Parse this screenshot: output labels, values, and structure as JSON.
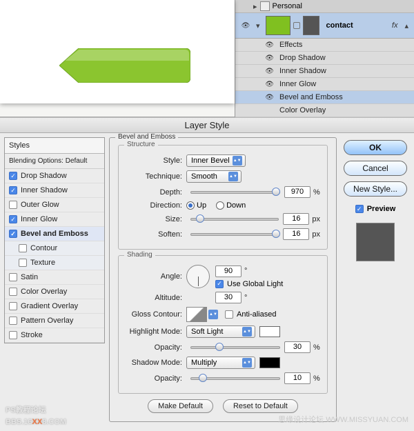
{
  "layers": {
    "personal_label": "Personal",
    "current_layer": "contact",
    "fx_badge": "fx",
    "effects_label": "Effects",
    "effects": [
      "Drop Shadow",
      "Inner Shadow",
      "Inner Glow",
      "Bevel and Emboss",
      "Color Overlay"
    ]
  },
  "dialog": {
    "title": "Layer Style",
    "styles_header": "Styles",
    "blending_label": "Blending Options: Default",
    "style_list": [
      {
        "label": "Drop Shadow",
        "checked": true
      },
      {
        "label": "Inner Shadow",
        "checked": true
      },
      {
        "label": "Outer Glow",
        "checked": false
      },
      {
        "label": "Inner Glow",
        "checked": true
      },
      {
        "label": "Bevel and Emboss",
        "checked": true,
        "selected": true
      },
      {
        "label": "Contour",
        "checked": false,
        "sub": true
      },
      {
        "label": "Texture",
        "checked": false,
        "sub": true
      },
      {
        "label": "Satin",
        "checked": false
      },
      {
        "label": "Color Overlay",
        "checked": false
      },
      {
        "label": "Gradient Overlay",
        "checked": false
      },
      {
        "label": "Pattern Overlay",
        "checked": false
      },
      {
        "label": "Stroke",
        "checked": false
      }
    ],
    "panel_title": "Bevel and Emboss",
    "structure": {
      "heading": "Structure",
      "style_label": "Style:",
      "style_value": "Inner Bevel",
      "technique_label": "Technique:",
      "technique_value": "Smooth",
      "depth_label": "Depth:",
      "depth_value": "970",
      "depth_unit": "%",
      "direction_label": "Direction:",
      "up_label": "Up",
      "down_label": "Down",
      "size_label": "Size:",
      "size_value": "16",
      "size_unit": "px",
      "soften_label": "Soften:",
      "soften_value": "16",
      "soften_unit": "px"
    },
    "shading": {
      "heading": "Shading",
      "angle_label": "Angle:",
      "angle_value": "90",
      "angle_unit": "°",
      "global_light_label": "Use Global Light",
      "altitude_label": "Altitude:",
      "altitude_value": "30",
      "altitude_unit": "°",
      "gloss_label": "Gloss Contour:",
      "antialiased_label": "Anti-aliased",
      "highlight_mode_label": "Highlight Mode:",
      "highlight_mode_value": "Soft Light",
      "highlight_color": "#ffffff",
      "h_opacity_label": "Opacity:",
      "h_opacity_value": "30",
      "h_opacity_unit": "%",
      "shadow_mode_label": "Shadow Mode:",
      "shadow_mode_value": "Multiply",
      "shadow_color": "#000000",
      "s_opacity_label": "Opacity:",
      "s_opacity_value": "10",
      "s_opacity_unit": "%"
    },
    "make_default": "Make Default",
    "reset_default": "Reset to Default",
    "ok": "OK",
    "cancel": "Cancel",
    "new_style": "New Style...",
    "preview": "Preview"
  },
  "watermark": {
    "left1": "PS教程论坛",
    "left2_a": "BBS.16",
    "left2_b": "XX",
    "left2_c": "8.COM",
    "right": "思缘设计论坛  WWW.MISSYUAN.COM"
  }
}
